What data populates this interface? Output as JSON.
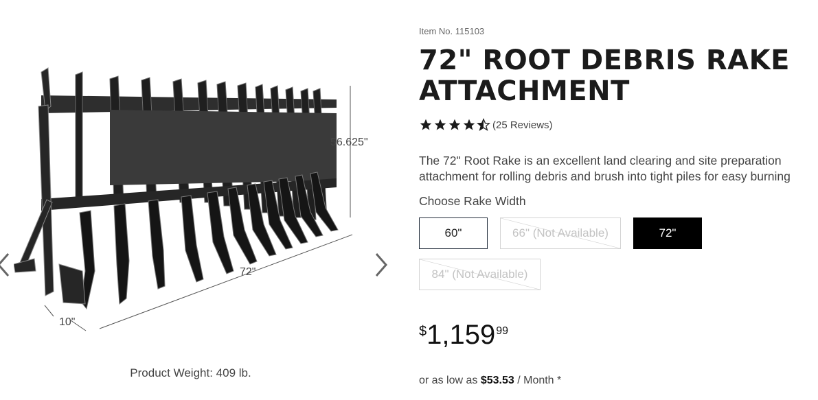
{
  "gallery": {
    "dimensions": {
      "height": "56.625\"",
      "width": "72\"",
      "depth": "10\""
    },
    "weight_text": "Product Weight: 409 lb.",
    "prev_icon": "chevron-left-icon",
    "next_icon": "chevron-right-icon"
  },
  "product": {
    "item_no": "Item No. 115103",
    "title": "72\" ROOT DEBRIS RAKE ATTACHMENT",
    "rating": {
      "stars": 4.5,
      "max": 5,
      "reviews_text": "(25 Reviews)"
    },
    "description": "The 72\" Root Rake is an excellent land clearing and site preparation attachment for rolling debris and brush into tight piles for easy burning",
    "choose_label": "Choose Rake Width",
    "widths": [
      {
        "label": "60\"",
        "status": "available"
      },
      {
        "label": "66\" (Not Available)",
        "status": "unavailable"
      },
      {
        "label": "72\"",
        "status": "selected"
      },
      {
        "label": "84\" (Not Available)",
        "status": "unavailable"
      }
    ],
    "price": {
      "currency": "$",
      "dollars": "1,159",
      "cents": "99"
    },
    "financing": {
      "prefix": "or as low as",
      "amount": "$53.53",
      "suffix": "/ Month *"
    }
  },
  "colors": {
    "selected_bg": "#000000",
    "border": "#1f2a38",
    "unavailable": "#c3c3c3",
    "star": "#1b1b1b"
  }
}
